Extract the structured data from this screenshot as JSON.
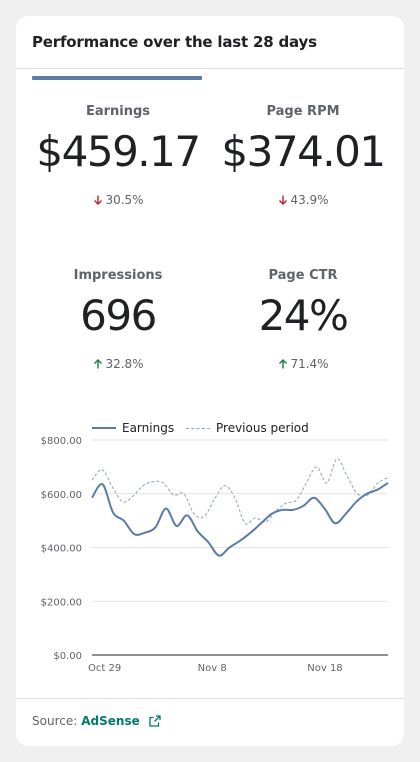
{
  "card": {
    "title": "Performance over the last 28 days"
  },
  "metrics": [
    {
      "label": "Earnings",
      "value": "$459.17",
      "change": "30.5%",
      "direction": "down",
      "selected": true
    },
    {
      "label": "Page RPM",
      "value": "$374.01",
      "change": "43.9%",
      "direction": "down",
      "selected": false
    },
    {
      "label": "Impressions",
      "value": "696",
      "change": "32.8%",
      "direction": "up",
      "selected": false
    },
    {
      "label": "Page CTR",
      "value": "24%",
      "change": "71.4%",
      "direction": "up",
      "selected": false
    }
  ],
  "colors": {
    "accent": "#5e7ba8",
    "down": "#c5221f",
    "up": "#188038",
    "link": "#00796b",
    "previous": "#8fa3bd"
  },
  "chart_data": {
    "type": "line",
    "legend": [
      "Earnings",
      "Previous period"
    ],
    "legend_position": "top",
    "y_ticks": [
      "$0.00",
      "$200.00",
      "$400.00",
      "$600.00",
      "$800.00"
    ],
    "ylim": [
      0,
      800
    ],
    "x_ticks": [
      {
        "label": "Oct 29",
        "index": 0
      },
      {
        "label": "Nov 8",
        "index": 10
      },
      {
        "label": "Nov 18",
        "index": 20
      }
    ],
    "x_count": 28,
    "grid": true,
    "series": [
      {
        "name": "Earnings",
        "style": "solid",
        "values": [
          585,
          635,
          530,
          500,
          450,
          455,
          475,
          545,
          480,
          520,
          460,
          420,
          370,
          400,
          425,
          455,
          490,
          525,
          540,
          540,
          555,
          585,
          545,
          490,
          525,
          570,
          600,
          615,
          640
        ]
      },
      {
        "name": "Previous period",
        "style": "dashed",
        "values": [
          650,
          690,
          625,
          570,
          590,
          630,
          645,
          640,
          595,
          600,
          525,
          515,
          580,
          630,
          585,
          490,
          510,
          495,
          535,
          565,
          575,
          640,
          700,
          640,
          730,
          665,
          600,
          595,
          640,
          660
        ]
      }
    ]
  },
  "footer": {
    "source_label": "Source:",
    "source_link": "AdSense"
  }
}
